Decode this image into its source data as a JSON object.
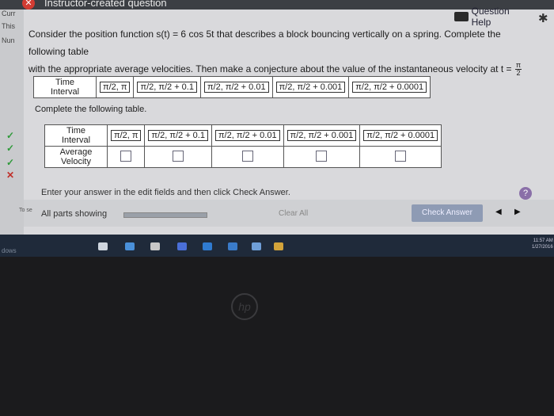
{
  "window": {
    "title": "Instructor-created question"
  },
  "sidebar": {
    "labels": [
      "Curr",
      "This",
      "Nun"
    ],
    "marks": [
      "✓",
      "✓",
      "✓",
      "✕"
    ],
    "to_see": "To se"
  },
  "header": {
    "help_label": "Question Help"
  },
  "question": {
    "line1": "Consider the position function s(t) = 6 cos 5t that describes a block bouncing vertically on a spring. Complete the following table",
    "line2": "with the appropriate average velocities. Then make a conjecture about the value of the instantaneous velocity at t =",
    "t_num": "π",
    "t_den": "2"
  },
  "table": {
    "head_time": [
      "Time",
      "Interval"
    ],
    "head_velocity": [
      "Average",
      "Velocity"
    ],
    "intervals": [
      {
        "a": "π/2",
        "b": "π"
      },
      {
        "a": "π/2",
        "b": "π/2 + 0.1"
      },
      {
        "a": "π/2",
        "b": "π/2 + 0.01"
      },
      {
        "a": "π/2",
        "b": "π/2 + 0.001"
      },
      {
        "a": "π/2",
        "b": "π/2 + 0.0001"
      }
    ]
  },
  "complete_label": "Complete the following table.",
  "footer": {
    "instruction": "Enter your answer in the edit fields and then click Check Answer.",
    "parts_showing": "All parts showing",
    "clear_all": "Clear All",
    "check_answer": "Check Answer",
    "progress": 1.0
  },
  "taskbar": {
    "label": "dows",
    "time": "11:57 AM",
    "date": "1/27/2016"
  },
  "colors": {
    "check": "#2f9a3a",
    "cross": "#c0302a",
    "help": "#8a6fa8"
  }
}
